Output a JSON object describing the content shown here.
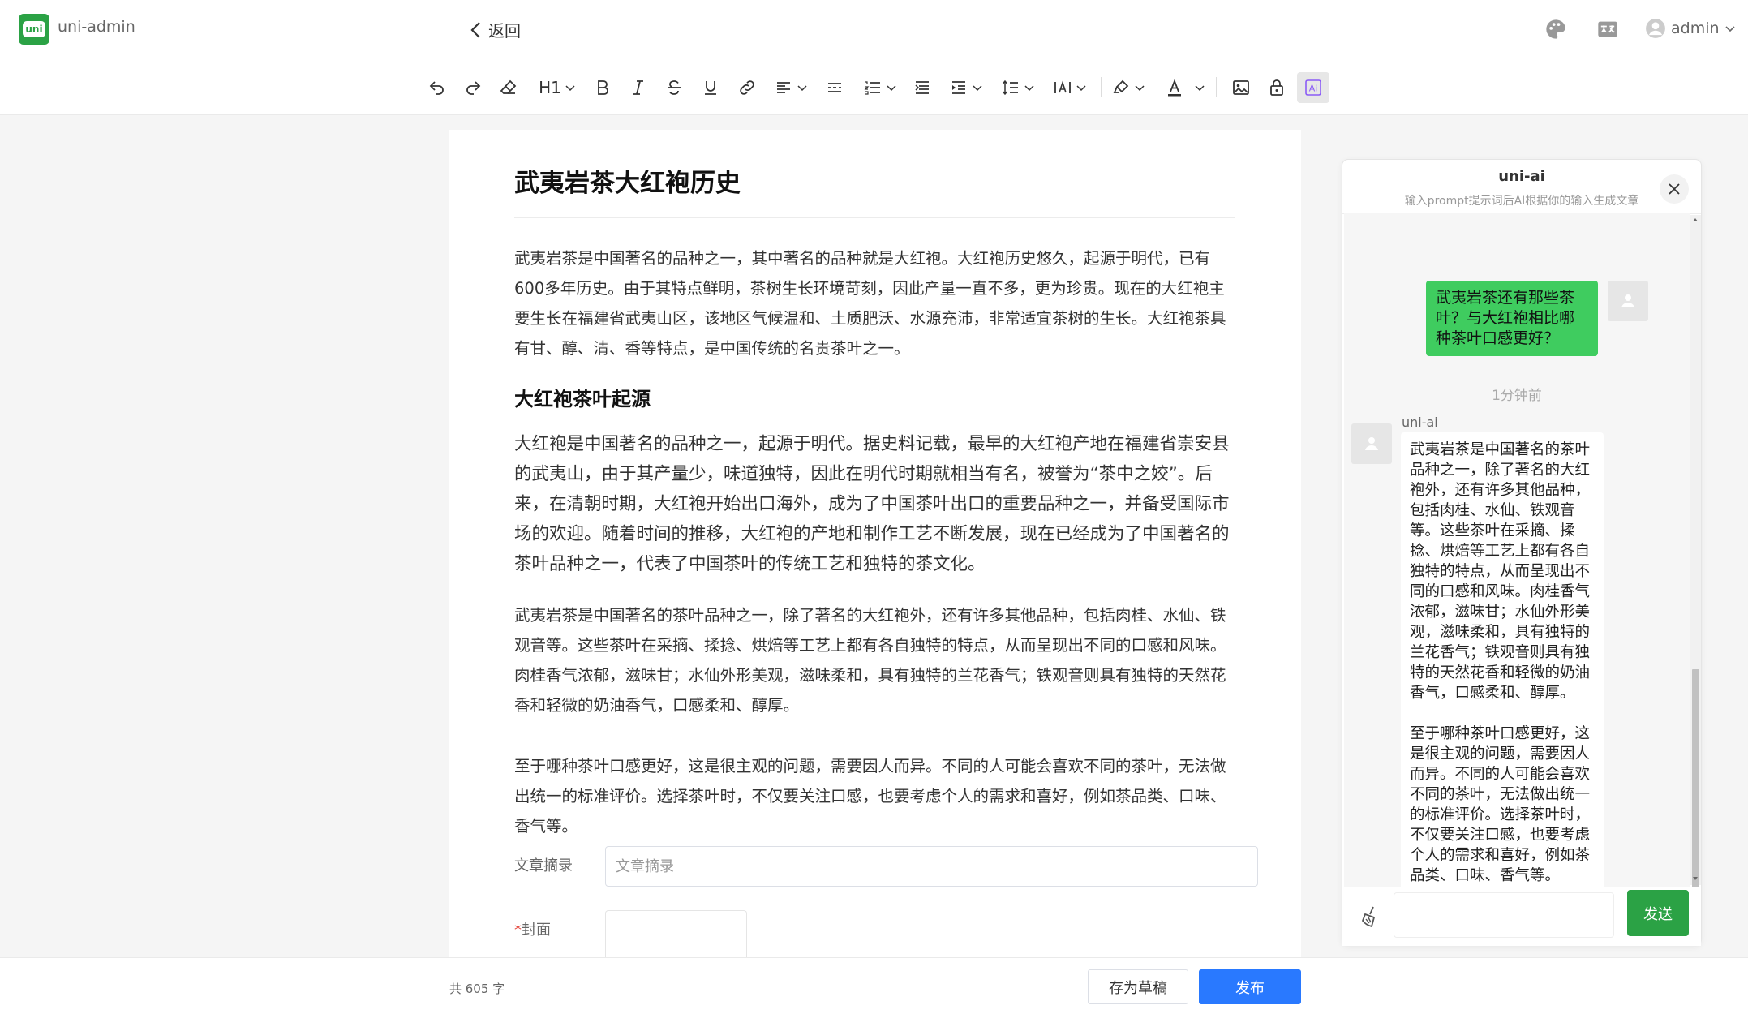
{
  "app": {
    "name": "uni-admin",
    "logo_text": "uni",
    "back_label": "返回",
    "user": "admin"
  },
  "toolbar": {
    "heading_label": "H1",
    "ai_label": "Ai"
  },
  "document": {
    "title": "武夷岩茶大红袍历史",
    "para1": "武夷岩茶是中国著名的品种之一，其中著名的品种就是大红袍。大红袍历史悠久，起源于明代，已有600多年历史。由于其特点鲜明，茶树生长环境苛刻，因此产量一直不多，更为珍贵。现在的大红袍主要生长在福建省武夷山区，该地区气候温和、土质肥沃、水源充沛，非常适宜茶树的生长。大红袍茶具有甘、醇、清、香等特点，是中国传统的名贵茶叶之一。",
    "heading2": "大红袍茶叶起源",
    "para2": "大红袍是中国著名的品种之一，起源于明代。据史料记载，最早的大红袍产地在福建省崇安县的武夷山，由于其产量少，味道独特，因此在明代时期就相当有名，被誉为“茶中之姣”。后来，在清朝时期，大红袍开始出口海外，成为了中国茶叶出口的重要品种之一，并备受国际市场的欢迎。随着时间的推移，大红袍的产地和制作工艺不断发展，现在已经成为了中国著名的茶叶品种之一，代表了中国茶叶的传统工艺和独特的茶文化。",
    "para3": "武夷岩茶是中国著名的茶叶品种之一，除了著名的大红袍外，还有许多其他品种，包括肉桂、水仙、铁观音等。这些茶叶在采摘、揉捻、烘焙等工艺上都有各自独特的特点，从而呈现出不同的口感和风味。肉桂香气浓郁，滋味甘；水仙外形美观，滋味柔和，具有独特的兰花香气；铁观音则具有独特的天然花香和轻微的奶油香气，口感柔和、醇厚。",
    "para4": "至于哪种茶叶口感更好，这是很主观的问题，需要因人而异。不同的人可能会喜欢不同的茶叶，无法做出统一的标准评价。选择茶叶时，不仅要关注口感，也要考虑个人的需求和喜好，例如茶品类、口味、香气等。"
  },
  "form": {
    "summary_label": "文章摘录",
    "summary_placeholder": "文章摘录",
    "summary_value": "",
    "cover_required_mark": "*",
    "cover_label": "封面"
  },
  "footer": {
    "word_count": "共 605 字",
    "draft_label": "存为草稿",
    "publish_label": "发布"
  },
  "ai_panel": {
    "title": "uni-ai",
    "subtitle": "输入prompt提示词后AI根据你的输入生成文章",
    "user_message": "武夷岩茶还有那些茶叶？与大红袍相比哪种茶叶口感更好？",
    "time": "1分钟前",
    "bot_name": "uni-ai",
    "bot_message": "武夷岩茶是中国著名的茶叶品种之一，除了著名的大红袍外，还有许多其他品种，包括肉桂、水仙、铁观音等。这些茶叶在采摘、揉捻、烘焙等工艺上都有各自独特的特点，从而呈现出不同的口感和风味。肉桂香气浓郁，滋味甘；水仙外形美观，滋味柔和，具有独特的兰花香气；铁观音则具有独特的天然花香和轻微的奶油香气，口感柔和、醇厚。\n\n至于哪种茶叶口感更好，这是很主观的问题，需要因人而异。不同的人可能会喜欢不同的茶叶，无法做出统一的标准评价。选择茶叶时，不仅要关注口感，也要考虑个人的需求和喜好，例如茶品类、口味、香气等。",
    "input_value": "",
    "send_label": "发送"
  },
  "colors": {
    "brand": "#2ba245",
    "primary": "#2979ff",
    "user_bubble": "#3fcc5f",
    "required": "#e43d33"
  }
}
